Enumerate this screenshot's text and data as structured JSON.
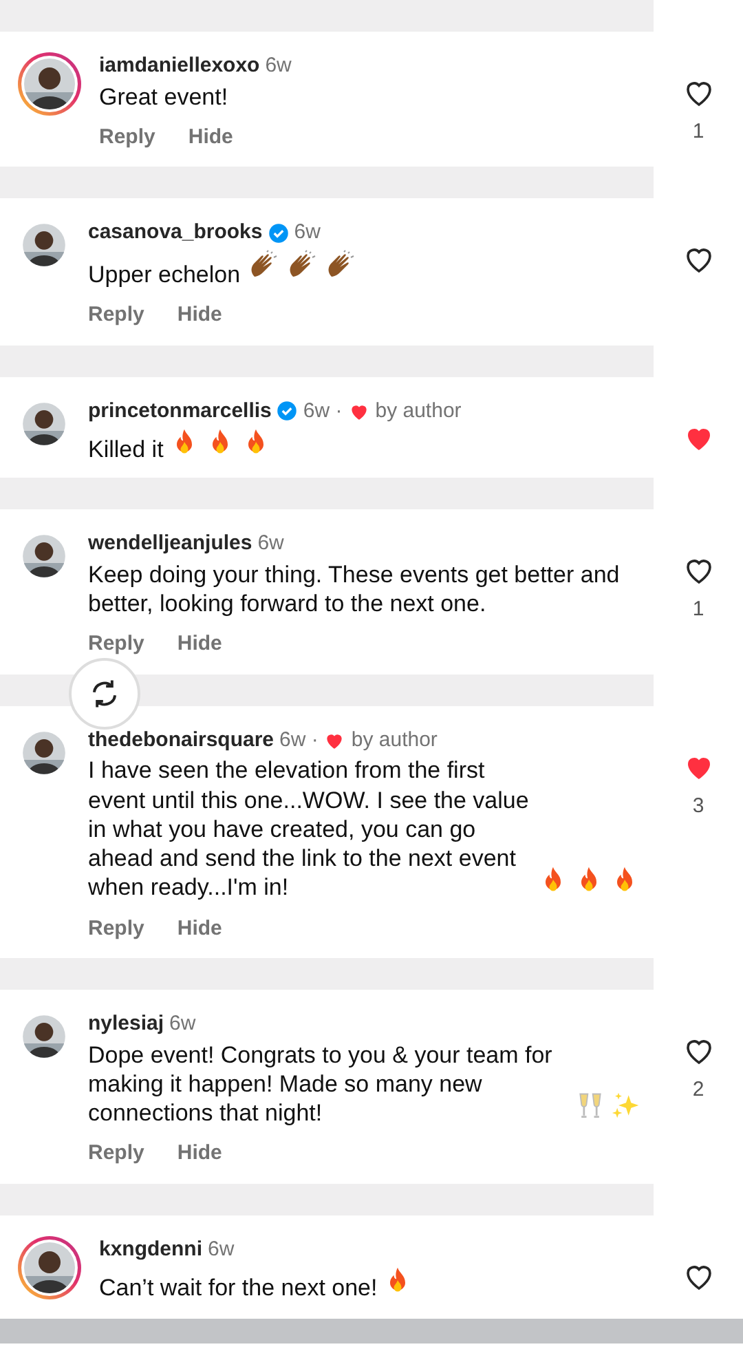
{
  "comments": [
    {
      "username": "iamdaniellexoxo",
      "verified": false,
      "time": "6w",
      "story_ring": true,
      "liked_by_author": false,
      "text": "Great event!",
      "actions": [
        "Reply",
        "Hide"
      ],
      "liked": false,
      "count": "1"
    },
    {
      "username": "casanova_brooks",
      "verified": true,
      "time": "6w",
      "story_ring": false,
      "liked_by_author": false,
      "text": "Upper echelon",
      "emoji": [
        {
          "kind": "clap"
        },
        {
          "kind": "clap"
        },
        {
          "kind": "clap"
        }
      ],
      "actions": [
        "Reply",
        "Hide"
      ],
      "liked": false
    },
    {
      "username": "princetonmarcellis",
      "verified": true,
      "time": "6w ·",
      "story_ring": false,
      "liked_by_author": true,
      "author_label": "by author",
      "text": "Killed it",
      "emoji": [
        {
          "kind": "fire"
        },
        {
          "kind": "fire"
        },
        {
          "kind": "fire"
        }
      ],
      "liked": true
    },
    {
      "username": "wendelljeanjules",
      "verified": false,
      "time": "6w",
      "story_ring": false,
      "liked_by_author": false,
      "text": "Keep doing your thing. These events get better and better, looking forward to the next one.",
      "actions": [
        "Reply",
        "Hide"
      ],
      "liked": false,
      "count": "1",
      "refresh_overlay": true
    },
    {
      "username": "thedebonairsquare",
      "verified": false,
      "time": "6w ·",
      "story_ring": false,
      "liked_by_author": true,
      "author_label": "by author",
      "text": "I have seen the elevation from the first event until this one...WOW. I see the value in what you have created, you can go ahead and send the link to the next event when ready...I'm in!",
      "emoji": [
        {
          "kind": "fire"
        },
        {
          "kind": "fire"
        },
        {
          "kind": "fire"
        }
      ],
      "actions": [
        "Reply",
        "Hide"
      ],
      "liked": true,
      "count": "3"
    },
    {
      "username": "nylesiaj",
      "verified": false,
      "time": "6w",
      "story_ring": false,
      "liked_by_author": false,
      "text": "Dope event! Congrats to you & your team for making it happen! Made so many new connections that night!",
      "emoji": [
        {
          "kind": "glasses"
        },
        {
          "kind": "sparkles"
        }
      ],
      "actions": [
        "Reply",
        "Hide"
      ],
      "liked": false,
      "count": "2"
    },
    {
      "username": "kxngdenni",
      "verified": false,
      "time": "6w",
      "story_ring": true,
      "liked_by_author": false,
      "text": "Can’t wait for the next one!",
      "emoji": [
        {
          "kind": "fire"
        }
      ],
      "liked": false
    }
  ]
}
